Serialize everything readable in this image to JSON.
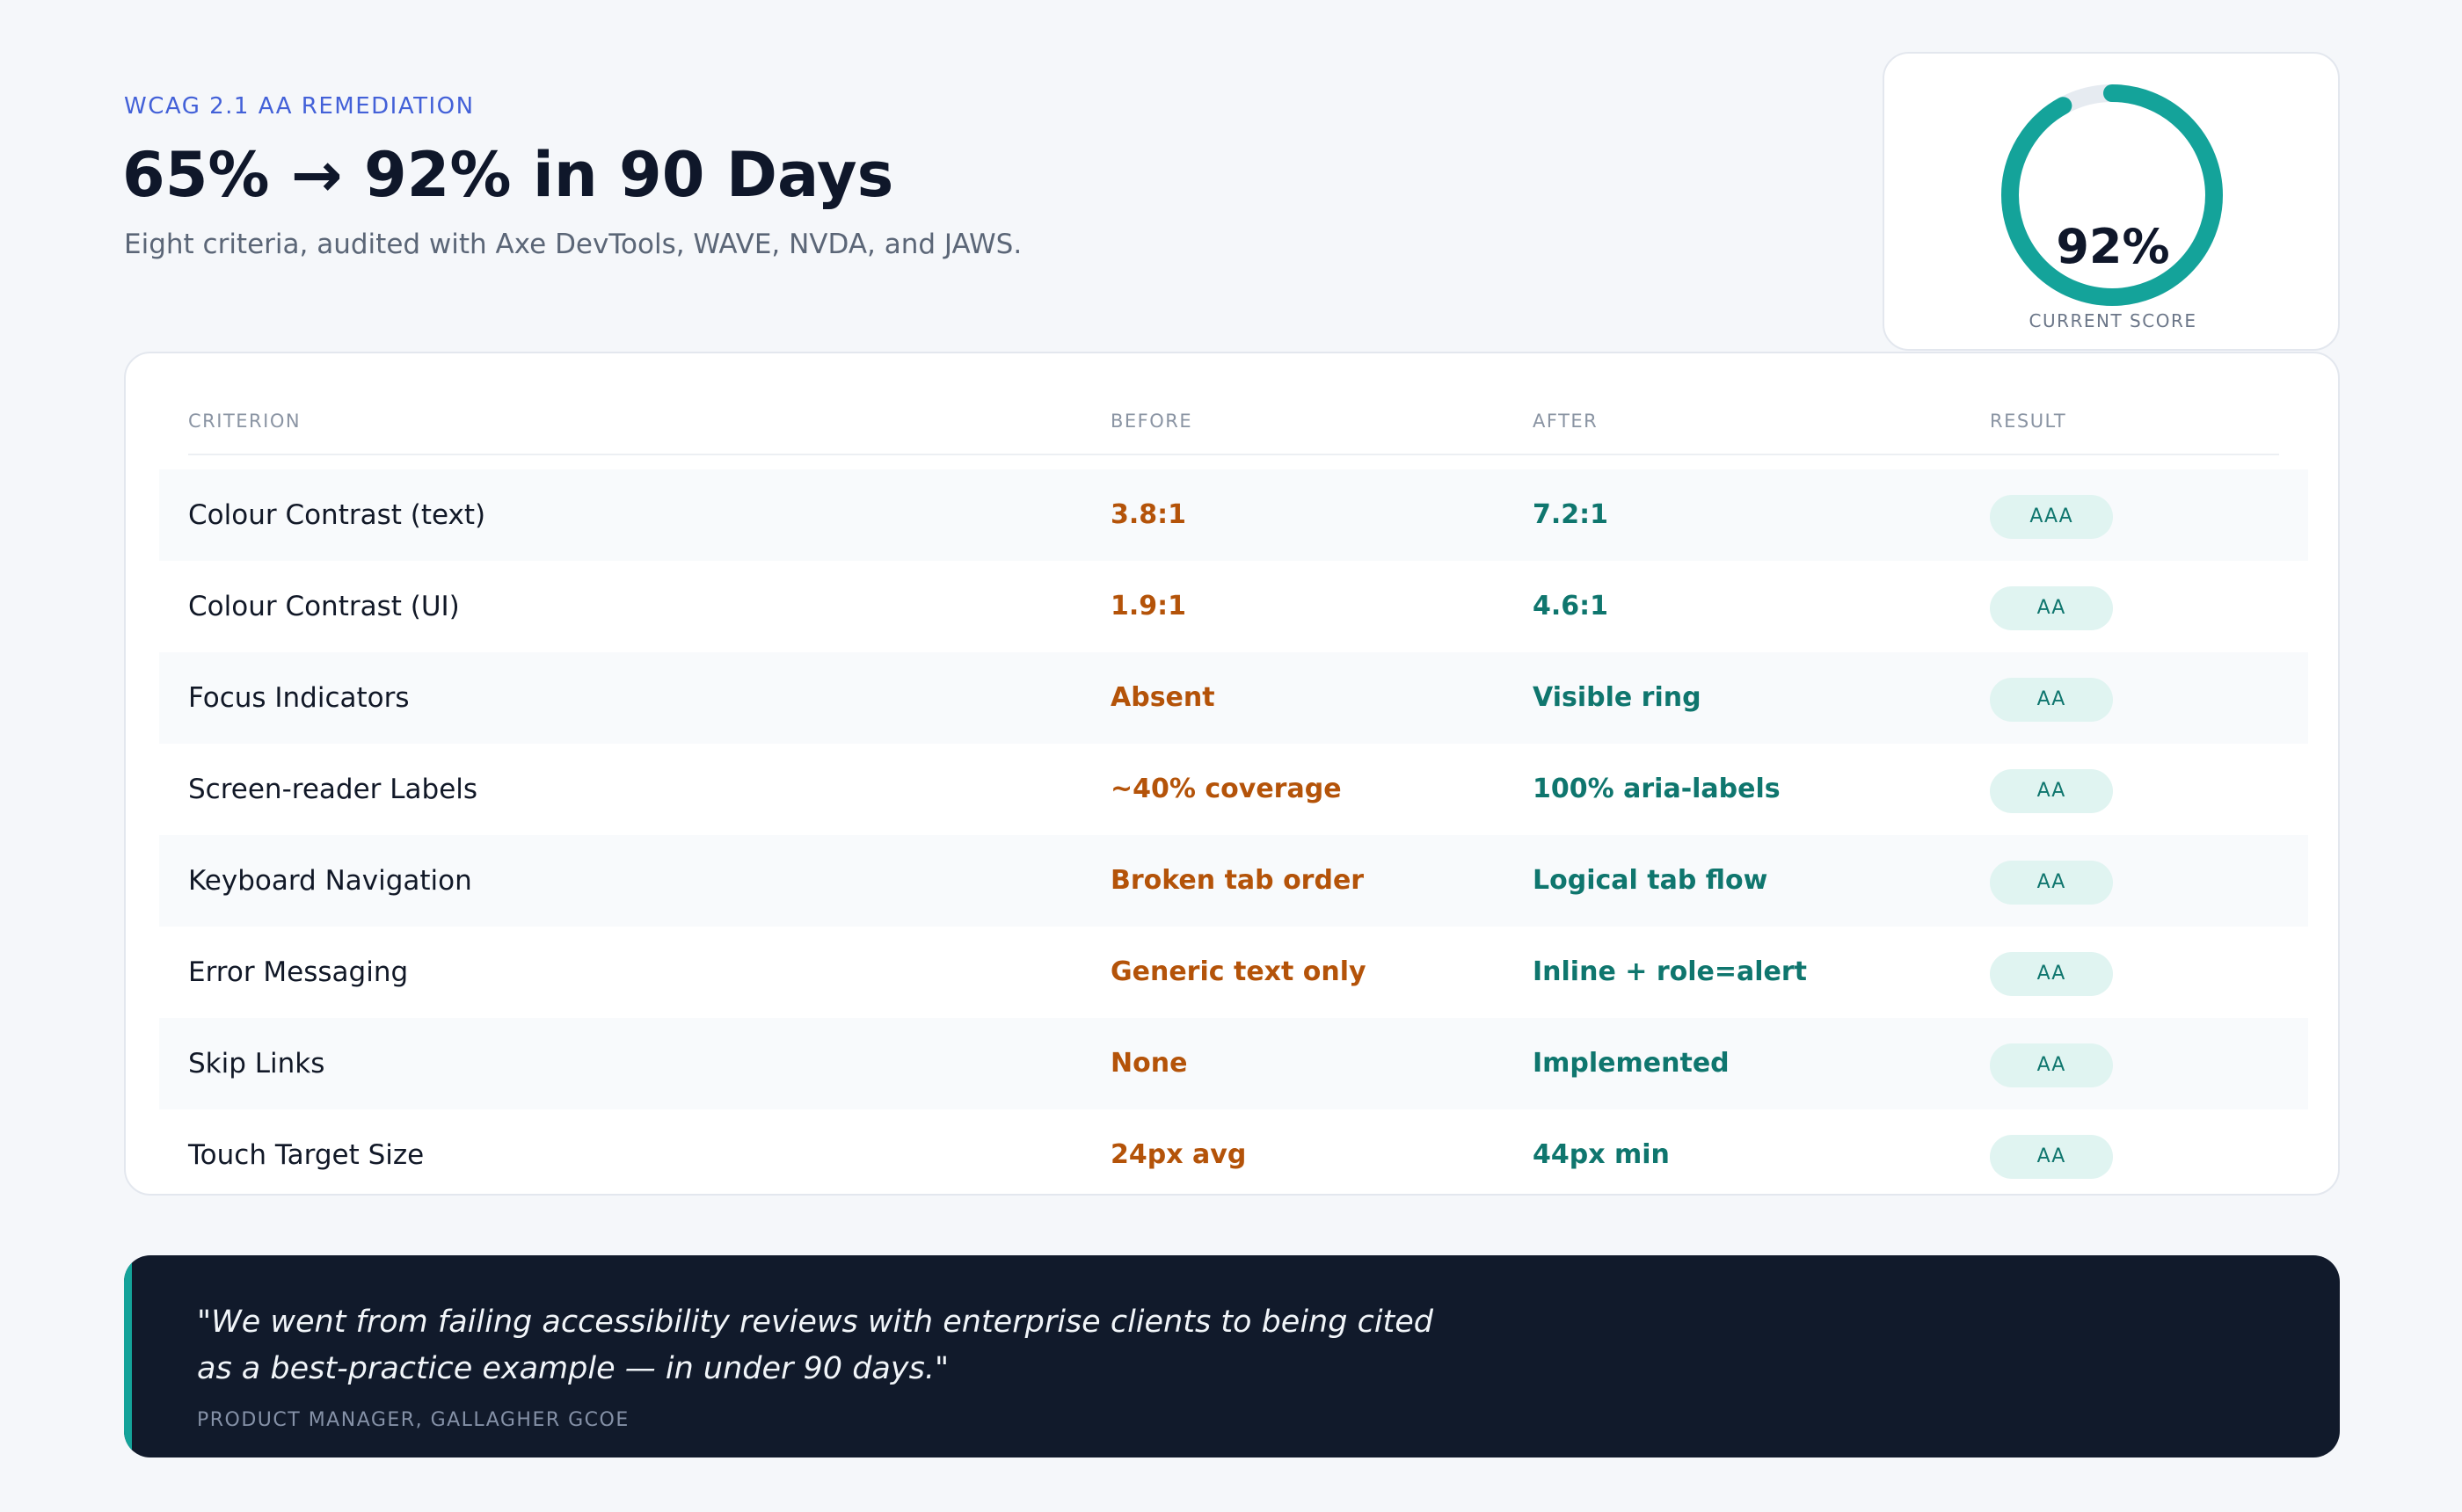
{
  "header": {
    "eyebrow": "WCAG 2.1 AA REMEDIATION",
    "headline": "65% → 92% in 90 Days",
    "subhead": "Eight criteria, audited with Axe DevTools, WAVE, NVDA, and JAWS."
  },
  "score": {
    "value": "92%",
    "progress": 0.92,
    "label": "CURRENT SCORE",
    "ring_color": "#14a39a",
    "track_color": "#e6ebf1"
  },
  "table": {
    "columns": [
      "CRITERION",
      "BEFORE",
      "AFTER",
      "RESULT"
    ],
    "rows": [
      {
        "criterion": "Colour Contrast (text)",
        "before": "3.8:1",
        "after": "7.2:1",
        "result": "AAA"
      },
      {
        "criterion": "Colour Contrast (UI)",
        "before": "1.9:1",
        "after": "4.6:1",
        "result": "AA"
      },
      {
        "criterion": "Focus Indicators",
        "before": "Absent",
        "after": "Visible ring",
        "result": "AA"
      },
      {
        "criterion": "Screen-reader Labels",
        "before": "~40% coverage",
        "after": "100% aria-labels",
        "result": "AA"
      },
      {
        "criterion": "Keyboard Navigation",
        "before": "Broken tab order",
        "after": "Logical tab flow",
        "result": "AA"
      },
      {
        "criterion": "Error Messaging",
        "before": "Generic text only",
        "after": "Inline + role=alert",
        "result": "AA"
      },
      {
        "criterion": "Skip Links",
        "before": "None",
        "after": "Implemented",
        "result": "AA"
      },
      {
        "criterion": "Touch Target Size",
        "before": "24px avg",
        "after": "44px min",
        "result": "AA"
      }
    ]
  },
  "quote": {
    "text": "\"We went from failing accessibility reviews with enterprise clients to being cited as a best-practice example — in under 90 days.\"",
    "attribution": "PRODUCT MANAGER, GALLAGHER GCOE"
  },
  "colors": {
    "accent": "#4361d8",
    "before": "#b45309",
    "after": "#0f766e",
    "badge_bg": "#e0f4f1",
    "quote_bg": "#111a2b"
  }
}
